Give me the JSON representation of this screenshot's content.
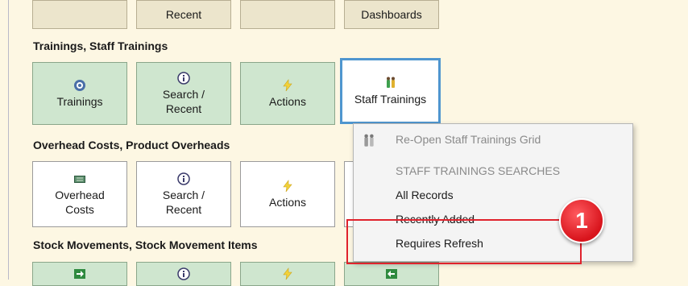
{
  "sections": [
    {
      "title": "Trainings,  Staff Trainings"
    },
    {
      "title": "Overhead Costs,  Product Overheads"
    },
    {
      "title": "Stock Movements,  Stock Movement Items"
    }
  ],
  "top_row": [
    "",
    "Recent",
    "",
    "Dashboards"
  ],
  "trainings_row": [
    {
      "label": "Trainings",
      "icon": "globe-icon"
    },
    {
      "label": "Search /\nRecent",
      "icon": "info-icon"
    },
    {
      "label": "Actions",
      "icon": "lightning-icon"
    },
    {
      "label": "Staff Trainings",
      "icon": "people-icon"
    }
  ],
  "overheads_row": [
    {
      "label": "Overhead\nCosts",
      "icon": "money-icon"
    },
    {
      "label": "Search /\nRecent",
      "icon": "info-icon"
    },
    {
      "label": "Actions",
      "icon": "lightning-icon"
    }
  ],
  "context_menu": {
    "reopen": "Re-Open Staff Trainings Grid",
    "header": "STAFF TRAININGS  SEARCHES",
    "items": [
      "All Records",
      "Recently Added",
      "Requires Refresh"
    ]
  },
  "annotation": {
    "badge_number": "1"
  },
  "colors": {
    "background": "#fdf7e3",
    "green_tile": "#cfe6cf",
    "selected_border": "#4f96cf",
    "annotation_red": "#e0222c"
  }
}
